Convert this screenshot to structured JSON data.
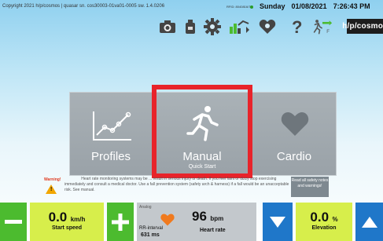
{
  "status_bar": {
    "copyright": "Copyright 2021 h/p/cosmos | quasar  sn. cos30003-01va01-0005  sw. 1.4.0206",
    "rfid": "RFID: 8040816/7",
    "day": "Sunday",
    "date": "01/08/2021",
    "time": "7:26:43 PM"
  },
  "toolbar": {
    "icons": [
      "camera-icon",
      "bottle-icon",
      "gear-icon",
      "chart-icon",
      "heart-settings-icon",
      "help-icon",
      "runner-flag-icon"
    ],
    "brand": "h/p/cosmos"
  },
  "tiles": {
    "profiles": {
      "label": "Profiles"
    },
    "manual": {
      "label": "Manual",
      "sub": "Quick Start"
    },
    "cardio": {
      "label": "Cardio"
    }
  },
  "warning": {
    "label": "Warning!",
    "text": "Heart rate monitoring systems may be ... result in serious injury or death. If you feel faint or dizzy stop exercising immediately and consult a medical doctor. Use a fall prevention system (safety arch & harness) if a fall would be an unacceptable risk. See manual.",
    "safety_button": "Read all safety notes and warnings!"
  },
  "speed": {
    "value": "0.0",
    "unit": "km/h",
    "caption": "Start speed"
  },
  "heart": {
    "mode": "Analog",
    "rr_label": "RR-interval",
    "rr_value": "631",
    "rr_unit": "ms",
    "value": "96",
    "unit": "bpm",
    "caption": "Heart rate"
  },
  "elevation": {
    "value": "0.0",
    "unit": "%",
    "caption": "Elevation"
  },
  "colors": {
    "green": "#4cbb2f",
    "lime": "#d7ee4b",
    "blue": "#1f77c9",
    "highlight_red": "#e8232a",
    "heart_orange": "#f07a1e"
  }
}
